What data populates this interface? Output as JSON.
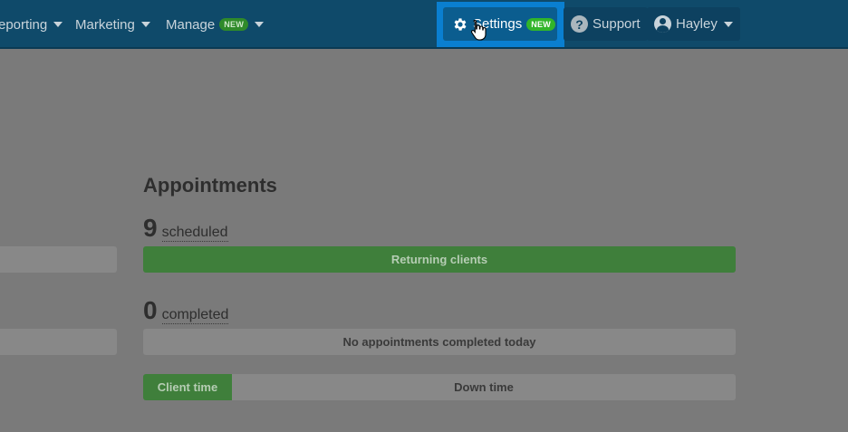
{
  "nav": {
    "reporting": "eporting",
    "marketing": "Marketing",
    "manage": "Manage",
    "manage_badge": "NEW",
    "settings": "Settings",
    "settings_badge": "NEW",
    "support": "Support",
    "user": "Hayley"
  },
  "appointments": {
    "title": "Appointments",
    "scheduled_count": "9",
    "scheduled_label": "scheduled",
    "returning_bar": "Returning clients",
    "completed_count": "0",
    "completed_label": "completed",
    "completed_bar": "No appointments completed today",
    "client_time": "Client time",
    "down_time": "Down time"
  },
  "colors": {
    "topbar": "#0f4a6a",
    "settings_highlight": "#0a7fd0",
    "overlay_background": "#7a7a7a",
    "green_bar": "#3f7f3b",
    "grey_bar": "#888888"
  },
  "icons": [
    "gear-icon",
    "help-icon",
    "user-icon",
    "caret-down-icon",
    "hand-cursor-icon"
  ]
}
